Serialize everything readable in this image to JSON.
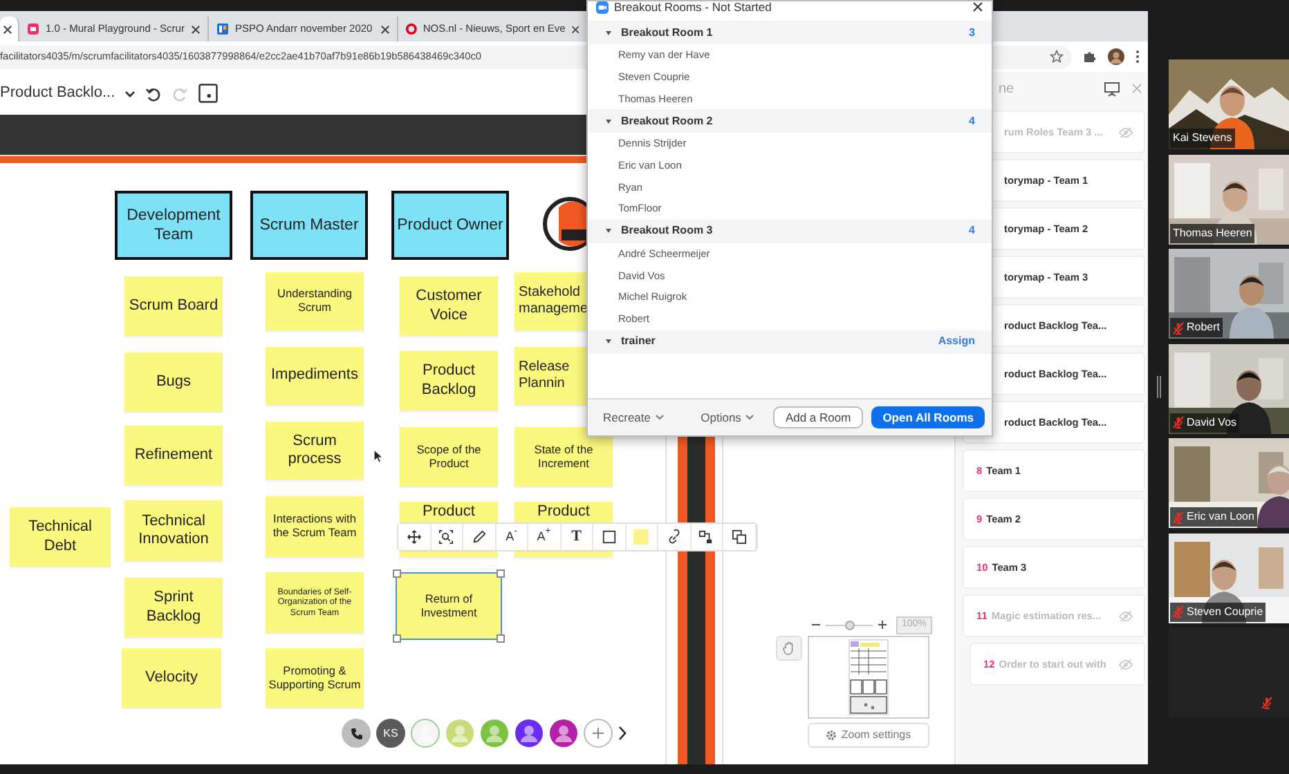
{
  "browser": {
    "tabs": [
      {
        "selected": true
      },
      {
        "label": "1.0 - Mural Playground - Scrur",
        "kind": "mural",
        "selected": false
      },
      {
        "label": "PSPO Andarr november 2020",
        "kind": "board",
        "selected": false
      },
      {
        "label": "NOS.nl - Nieuws, Sport en Eve",
        "kind": "ring",
        "selected": false
      }
    ],
    "url": "facilitators4035/m/scrumfacilitators4035/1603877998864/e2cc2ae41b70af7b91e86b19b586438469c340c0"
  },
  "mural_toolbar": {
    "board_name": "Product Backlo...",
    "tools": [
      {
        "kind": "undo",
        "disabled": false
      },
      {
        "kind": "redo",
        "disabled": true
      },
      {
        "kind": "frame",
        "disabled": false
      }
    ]
  },
  "canvas": {
    "headers": [
      "Development Team",
      "Scrum Master",
      "Product Owner"
    ],
    "stickies": [
      {
        "text": "Technical Debt",
        "selected": false
      },
      {
        "text": "Scrum Board",
        "selected": false
      },
      {
        "text": "Bugs",
        "selected": false
      },
      {
        "text": "Refinement",
        "selected": false
      },
      {
        "text": "Technical Innovation",
        "selected": false
      },
      {
        "text": "Sprint Backlog",
        "selected": false
      },
      {
        "text": "Velocity",
        "selected": false
      },
      {
        "text": "Understanding Scrum",
        "selected": false
      },
      {
        "text": "Impediments",
        "selected": false
      },
      {
        "text": "Scrum process",
        "selected": false
      },
      {
        "text": "Interactions with the Scrum Team",
        "selected": false
      },
      {
        "text": "Boundaries of Self-Organization of the Scrum Team",
        "selected": false
      },
      {
        "text": "Promoting & Supporting Scrum",
        "selected": false
      },
      {
        "text": "Customer Voice",
        "selected": false
      },
      {
        "text": "Product Backlog",
        "selected": false
      },
      {
        "text": "Scope of the Product",
        "selected": false
      },
      {
        "text": "Product",
        "selected": false
      },
      {
        "text": "Return of Investment",
        "selected": true
      },
      {
        "text": "Stakehold manageme",
        "selected": false
      },
      {
        "text": "Release Plannin",
        "selected": false
      },
      {
        "text": "State of the Increment",
        "selected": false
      },
      {
        "text": "Product",
        "selected": false
      }
    ],
    "toolbar": [
      {
        "kind": "move"
      },
      {
        "kind": "zoom"
      },
      {
        "kind": "pen"
      },
      {
        "kind": "label",
        "label": "A$^{-}$"
      },
      {
        "kind": "label",
        "label": "A$^{+}$"
      },
      {
        "kind": "label",
        "label": "T"
      },
      {
        "kind": "shape"
      },
      {
        "kind": "swatch",
        "color": "#fff48a"
      },
      {
        "kind": "link"
      },
      {
        "kind": "connector"
      },
      {
        "kind": "copy"
      }
    ],
    "collaborators": [
      {
        "kind": "phone"
      },
      {
        "kind": "initials",
        "label": "KS"
      },
      {
        "kind": "avatar",
        "color": "#f4f4f4"
      },
      {
        "kind": "avatar",
        "color": "#c8dc78"
      },
      {
        "kind": "avatar",
        "color": "#7ec242"
      },
      {
        "kind": "avatar",
        "color": "#6a2cf0"
      },
      {
        "kind": "avatar",
        "color": "#b420a8"
      },
      {
        "kind": "add"
      },
      {
        "kind": "more"
      }
    ]
  },
  "minimap": {
    "zoom": "100%",
    "level": 0.5,
    "settings": "Zoom settings"
  },
  "outline": {
    "title": "ne",
    "items": [
      {
        "label": "rum Roles Team 3 ...",
        "hidden": true
      },
      {
        "label": "torymap - Team 1",
        "hidden": false
      },
      {
        "label": "torymap - Team 2",
        "hidden": false
      },
      {
        "label": "torymap - Team 3",
        "hidden": false
      },
      {
        "label": "roduct Backlog Tea...",
        "hidden": false
      },
      {
        "label": "roduct Backlog Tea...",
        "hidden": false
      },
      {
        "label": "roduct Backlog Tea...",
        "hidden": false
      },
      {
        "number": "8",
        "label": "Team 1",
        "hidden": false
      },
      {
        "number": "9",
        "label": "Team 2",
        "hidden": false
      },
      {
        "number": "10",
        "label": "Team 3",
        "hidden": false
      },
      {
        "number": "11",
        "label": "Magic estimation res...",
        "hidden": true
      },
      {
        "number": "12",
        "label": "Order to start out with",
        "hidden": true
      }
    ]
  },
  "breakout_dialog": {
    "title": "Breakout Rooms - Not Started",
    "rooms": [
      {
        "name": "Breakout Room 1",
        "count": "3",
        "expanded": true,
        "members": [
          "Remy van der Have",
          "Steven Couprie",
          "Thomas Heeren"
        ]
      },
      {
        "name": "Breakout Room 2",
        "count": "4",
        "expanded": true,
        "members": [
          "Dennis Strijder",
          "Eric van Loon",
          "Ryan",
          "TomFloor"
        ]
      },
      {
        "name": "Breakout Room 3",
        "count": "4",
        "expanded": true,
        "members": [
          "André Scheermeijer",
          "David Vos",
          "Michel Ruigrok",
          "Robert"
        ]
      },
      {
        "name": "trainer",
        "action": "Assign",
        "expanded": true
      }
    ],
    "buttons": [
      {
        "label": "Recreate",
        "kind": "dropdown"
      },
      {
        "label": "Options",
        "kind": "dropdown"
      },
      {
        "label": "Add a Room",
        "kind": "outline"
      },
      {
        "label": "Open All Rooms",
        "kind": "primary"
      }
    ]
  },
  "participants": [
    {
      "name": "Kai Stevens",
      "muted": false,
      "video": true
    },
    {
      "name": "Thomas Heeren",
      "muted": false,
      "video": true
    },
    {
      "name": "Robert",
      "muted": true,
      "video": true
    },
    {
      "name": "David Vos",
      "muted": true,
      "video": true
    },
    {
      "name": "Eric van Loon",
      "muted": true,
      "video": true
    },
    {
      "name": "Steven Couprie",
      "muted": true,
      "video": true
    },
    {
      "muted": true,
      "video": false
    }
  ]
}
